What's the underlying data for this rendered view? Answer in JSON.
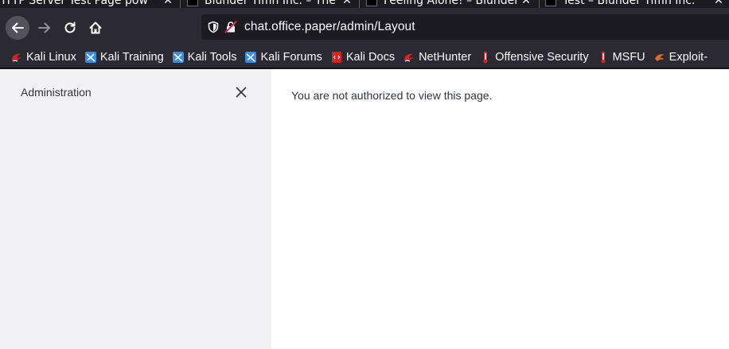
{
  "browser": {
    "tabs": [
      {
        "title": "HTTP Server Test Page pow",
        "active": false
      },
      {
        "title": "Blunder Tiffin Inc. – The",
        "active": false
      },
      {
        "title": "Feeling Alone! – Blunder",
        "active": false
      },
      {
        "title": "Test – Blunder Tiffin Inc.",
        "active": false
      }
    ],
    "tab_close_glyph": "✕",
    "url": "chat.office.paper/admin/Layout",
    "bookmarks": [
      {
        "label": "Kali Linux",
        "icon": "kali-dragon-icon"
      },
      {
        "label": "Kali Training",
        "icon": "kali-training-icon"
      },
      {
        "label": "Kali Tools",
        "icon": "kali-tools-icon"
      },
      {
        "label": "Kali Forums",
        "icon": "kali-forums-icon"
      },
      {
        "label": "Kali Docs",
        "icon": "kali-docs-icon"
      },
      {
        "label": "NetHunter",
        "icon": "nethunter-icon"
      },
      {
        "label": "Offensive Security",
        "icon": "offsec-icon"
      },
      {
        "label": "MSFU",
        "icon": "msfu-icon"
      },
      {
        "label": "Exploit-",
        "icon": "exploit-db-icon"
      }
    ]
  },
  "sidebar": {
    "title": "Administration",
    "close_icon": "close-icon"
  },
  "main": {
    "message": "You are not authorized to view this page."
  },
  "colors": {
    "browser_chrome": "#2b2a33",
    "urlbar_bg": "#1c1b22",
    "sidebar_bg": "#f2f2f4",
    "page_bg": "#ffffff",
    "text_dark": "#2f343d",
    "kali_red": "#d22626",
    "kali_blue": "#3b8de0"
  }
}
